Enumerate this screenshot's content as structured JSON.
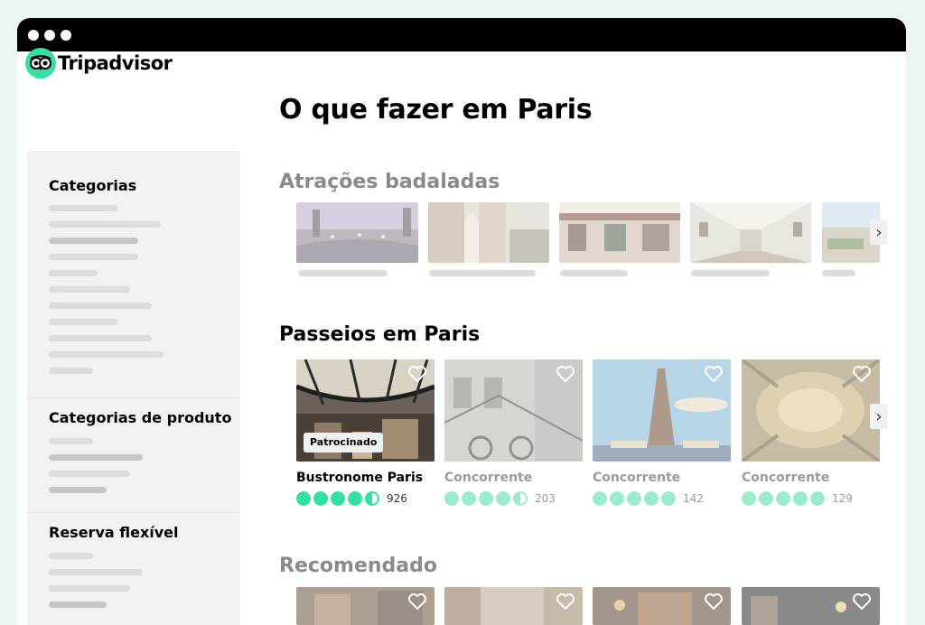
{
  "app": {
    "logo_text": "Tripadvisor",
    "logo_icon": "owl-eyes-icon",
    "brand_color": "#34e0a1"
  },
  "page": {
    "title": "O que fazer em Paris"
  },
  "sidebar": {
    "sections": [
      {
        "title": "Categorias"
      },
      {
        "title": "Categorias de produto"
      },
      {
        "title": "Reserva flexível"
      }
    ]
  },
  "trending": {
    "title": "Atrações badaladas"
  },
  "tours": {
    "title": "Passeios em Paris",
    "cards": [
      {
        "name": "Bustronome Paris",
        "badge": "Patrocinado",
        "rating": 4.5,
        "reviews": "926"
      },
      {
        "name": "Concorrente",
        "rating": 4.5,
        "reviews": "203"
      },
      {
        "name": "Concorrente",
        "rating": 5,
        "reviews": "142"
      },
      {
        "name": "Concorrente",
        "rating": 5,
        "reviews": "129"
      }
    ]
  },
  "recommended": {
    "title": "Recomendado"
  },
  "icons": {
    "heart": "heart-icon",
    "next": "chevron-right-icon"
  },
  "colors": {
    "rating_full": "#34e0a1",
    "rating_faded": "#9aeccd",
    "text_faded": "#9b9b9b"
  }
}
